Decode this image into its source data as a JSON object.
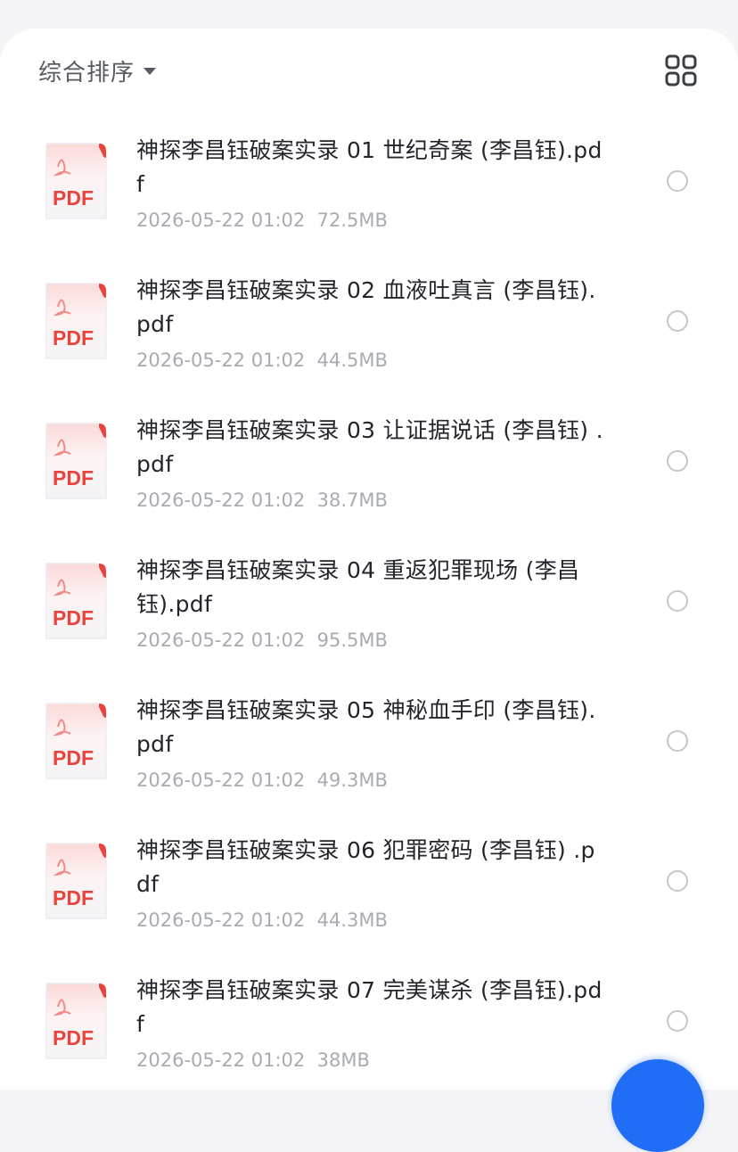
{
  "toolbar": {
    "sort_label": "综合排序",
    "sort_icon": "caret-down-icon",
    "view_toggle_icon": "grid-view-icon"
  },
  "files": [
    {
      "name": "神探李昌钰破案实录 01 世纪奇案 (李昌钰).pdf",
      "date": "2026-05-22 01:02",
      "size": "72.5MB",
      "type_label": "PDF"
    },
    {
      "name": "神探李昌钰破案实录 02 血液吐真言 (李昌钰).pdf",
      "date": "2026-05-22 01:02",
      "size": "44.5MB",
      "type_label": "PDF"
    },
    {
      "name": "神探李昌钰破案实录 03 让证据说话 (李昌钰) .pdf",
      "date": "2026-05-22 01:02",
      "size": "38.7MB",
      "type_label": "PDF"
    },
    {
      "name": "神探李昌钰破案实录 04 重返犯罪现场 (李昌钰).pdf",
      "date": "2026-05-22 01:02",
      "size": "95.5MB",
      "type_label": "PDF"
    },
    {
      "name": "神探李昌钰破案实录 05 神秘血手印 (李昌钰).pdf",
      "date": "2026-05-22 01:02",
      "size": "49.3MB",
      "type_label": "PDF"
    },
    {
      "name": "神探李昌钰破案实录 06 犯罪密码 (李昌钰) .pdf",
      "date": "2026-05-22 01:02",
      "size": "44.3MB",
      "type_label": "PDF"
    },
    {
      "name": "神探李昌钰破案实录 07 完美谋杀 (李昌钰).pdf",
      "date": "2026-05-22 01:02",
      "size": "38MB",
      "type_label": "PDF"
    }
  ],
  "colors": {
    "accent": "#1f6ef5",
    "pdf_red": "#e8433c",
    "text_primary": "#22252b",
    "text_secondary": "#a7abb2"
  }
}
